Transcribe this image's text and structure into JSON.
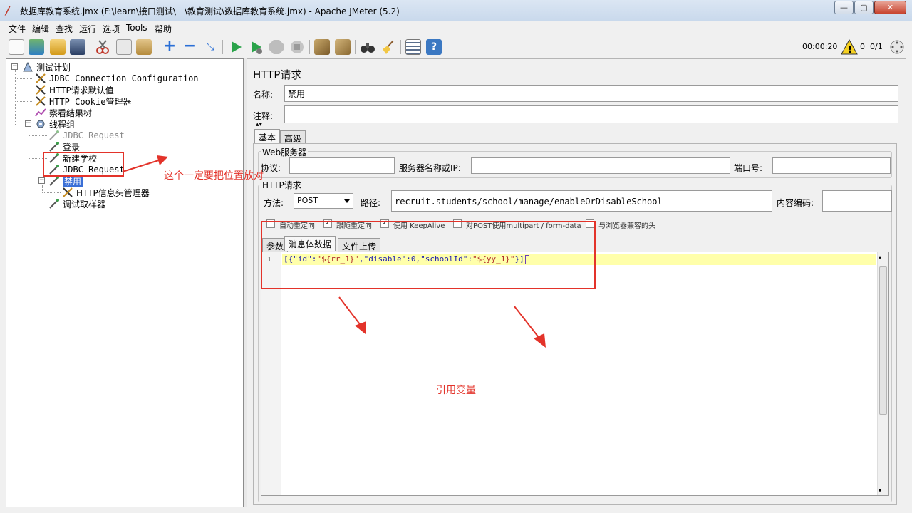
{
  "window": {
    "title": "数据库教育系统.jmx (F:\\learn\\接口测试\\一\\教育测试\\数据库教育系统.jmx) - Apache JMeter (5.2)",
    "minimize": "—",
    "maximize": "▢",
    "close": "✕"
  },
  "menu": [
    "文件",
    "编辑",
    "查找",
    "运行",
    "选项",
    "Tools",
    "帮助"
  ],
  "toolbar": {
    "timer": "00:00:20",
    "warning_count": "0",
    "threads": "0/1"
  },
  "tree": {
    "test_plan": "测试计划",
    "jdbc_config": "JDBC Connection Configuration",
    "http_defaults": "HTTP请求默认值",
    "cookie_manager": "HTTP Cookie管理器",
    "results_tree": "察看结果树",
    "thread_group": "线程组",
    "jdbc_request_1": "JDBC Request",
    "login": "登录",
    "new_school": "新建学校",
    "jdbc_request_2": "JDBC Request",
    "disable": "禁用",
    "header_manager": "HTTP信息头管理器",
    "debug_sampler": "调试取样器"
  },
  "panel": {
    "heading": "HTTP请求",
    "name_label": "名称:",
    "name_value": "禁用",
    "comment_label": "注释:",
    "comment_value": "",
    "tab_basic": "基本",
    "tab_advanced": "高级",
    "web_server_group": "Web服务器",
    "protocol_label": "协议:",
    "protocol_value": "",
    "server_label": "服务器名称或IP:",
    "server_value": "",
    "port_label": "端口号:",
    "port_value": "",
    "http_request_group": "HTTP请求",
    "method_label": "方法:",
    "method_value": "POST",
    "path_label": "路径:",
    "path_value": "recruit.students/school/manage/enableOrDisableSchool",
    "encoding_label": "内容编码:",
    "encoding_value": "",
    "checkboxes": [
      {
        "label": "自动重定向",
        "checked": false
      },
      {
        "label": "跟随重定向",
        "checked": true
      },
      {
        "label": "使用 KeepAlive",
        "checked": true
      },
      {
        "label": "对POST使用multipart / form-data",
        "checked": false
      },
      {
        "label": "与浏览器兼容的头",
        "checked": false
      }
    ],
    "subtab_params": "参数",
    "subtab_body": "消息体数据",
    "subtab_files": "文件上传",
    "line_number": "1",
    "body_code": "[{\"id\":\"${rr_1}\",\"disable\":0,\"schoolId\":\"${yy_1}\"}]"
  },
  "annotations": {
    "tree_note": "这个一定要把位置放对",
    "body_note": "引用变量"
  },
  "colors": {
    "annotation_red": "#e3332a",
    "selection_blue": "#3a6fd6",
    "code_string": "#b02b2b",
    "code_key": "#1c1cb0"
  }
}
